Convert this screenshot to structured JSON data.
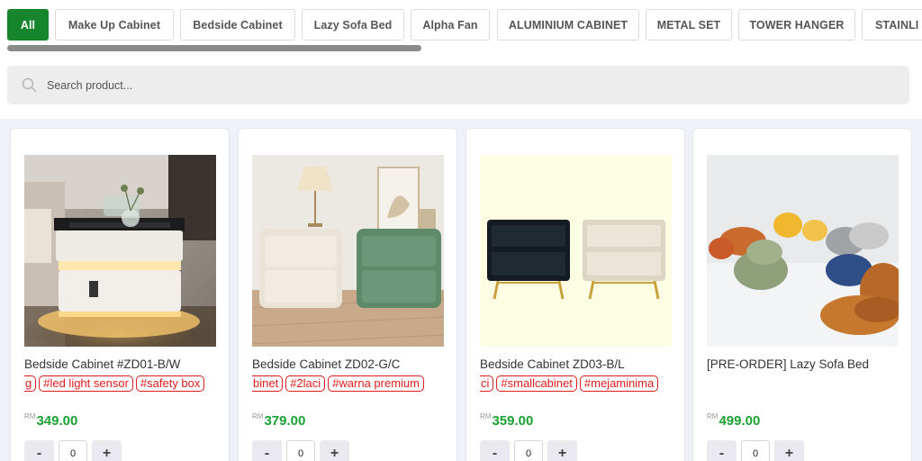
{
  "categories": [
    {
      "label": "All",
      "active": true
    },
    {
      "label": "Make Up Cabinet"
    },
    {
      "label": "Bedside Cabinet"
    },
    {
      "label": "Lazy Sofa Bed"
    },
    {
      "label": "Alpha Fan"
    },
    {
      "label": "ALUMINIUM CABINET"
    },
    {
      "label": "METAL SET"
    },
    {
      "label": "TOWER HANGER"
    },
    {
      "label": "STAINLI"
    }
  ],
  "search": {
    "placeholder": "Search product..."
  },
  "currency": "RM",
  "products": [
    {
      "name": "Bedside Cabinet #ZD01-B/W",
      "tags": [
        "g",
        "#led light sensor",
        "#safety box"
      ],
      "price": "349.00",
      "qty": "0"
    },
    {
      "name": "Bedside Cabinet ZD02-G/C",
      "tags": [
        "binet",
        "#2laci",
        "#warna premium"
      ],
      "price": "379.00",
      "qty": "0"
    },
    {
      "name": "Bedside Cabinet ZD03-B/L",
      "tags": [
        "ci",
        "#smallcabinet",
        "#mejaminima"
      ],
      "price": "359.00",
      "qty": "0"
    },
    {
      "name": "[PRE-ORDER] Lazy Sofa Bed",
      "tags": [],
      "price": "499.00",
      "qty": "0"
    }
  ],
  "stepper": {
    "minus": "-",
    "plus": "+"
  },
  "colors": {
    "accent": "#16852c",
    "price": "#19a132",
    "tag": "#e21b1b"
  }
}
